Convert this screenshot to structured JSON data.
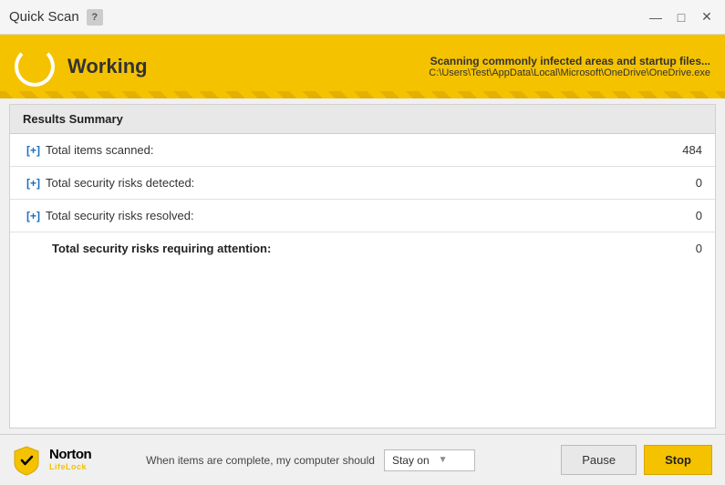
{
  "titleBar": {
    "title": "Quick Scan",
    "helpLabel": "?",
    "controls": {
      "minimize": "—",
      "maximize": "□",
      "close": "✕"
    }
  },
  "statusBar": {
    "workingLabel": "Working",
    "scanningText": "Scanning commonly infected areas and startup files...",
    "scanningFile": "C:\\Users\\Test\\AppData\\Local\\Microsoft\\OneDrive\\OneDrive.exe"
  },
  "results": {
    "header": "Results Summary",
    "rows": [
      {
        "expandBtn": "[+]",
        "label": "Total items scanned:",
        "value": "484",
        "bold": false
      },
      {
        "expandBtn": "[+]",
        "label": "Total security risks detected:",
        "value": "0",
        "bold": false
      },
      {
        "expandBtn": "[+]",
        "label": "Total security risks resolved:",
        "value": "0",
        "bold": false
      },
      {
        "expandBtn": "",
        "label": "Total security risks requiring attention:",
        "value": "0",
        "bold": true
      }
    ]
  },
  "footer": {
    "completionLabel": "When items are complete, my computer should",
    "stayOnLabel": "Stay on",
    "pauseButton": "Pause",
    "stopButton": "Stop",
    "nortonName": "Norton",
    "nortonSub": "LifeLock"
  }
}
